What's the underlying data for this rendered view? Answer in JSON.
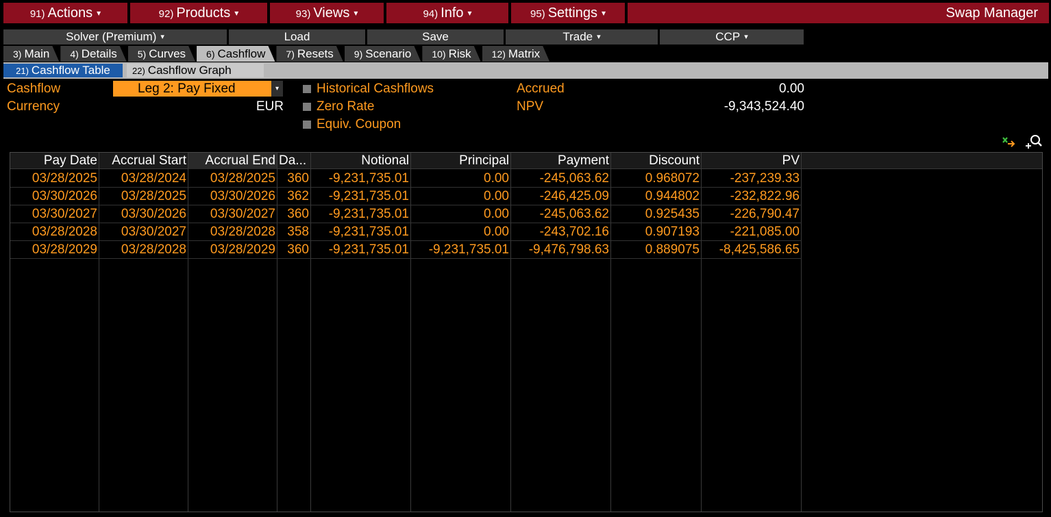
{
  "menubar": {
    "items": [
      {
        "num": "91)",
        "label": "Actions"
      },
      {
        "num": "92)",
        "label": "Products"
      },
      {
        "num": "93)",
        "label": "Views"
      },
      {
        "num": "94)",
        "label": "Info"
      },
      {
        "num": "95)",
        "label": "Settings"
      }
    ],
    "title": "Swap Manager"
  },
  "toolbar": {
    "solver": "Solver (Premium)",
    "load": "Load",
    "save": "Save",
    "trade": "Trade",
    "ccp": "CCP"
  },
  "tabs": [
    {
      "num": "3)",
      "label": "Main"
    },
    {
      "num": "4)",
      "label": "Details"
    },
    {
      "num": "5)",
      "label": "Curves"
    },
    {
      "num": "6)",
      "label": "Cashflow"
    },
    {
      "num": "7)",
      "label": "Resets"
    },
    {
      "num": "9)",
      "label": "Scenario"
    },
    {
      "num": "10)",
      "label": "Risk"
    },
    {
      "num": "12)",
      "label": "Matrix"
    }
  ],
  "active_tab": "Cashflow",
  "subtabs": {
    "table": {
      "num": "21)",
      "label": "Cashflow Table"
    },
    "graph": {
      "num": "22)",
      "label": "Cashflow Graph"
    }
  },
  "form": {
    "cashflow_label": "Cashflow",
    "cashflow_value": "Leg 2: Pay Fixed",
    "currency_label": "Currency",
    "currency_value": "EUR",
    "historical_label": "Historical Cashflows",
    "zero_rate_label": "Zero Rate",
    "equiv_coupon_label": "Equiv. Coupon",
    "accrued_label": "Accrued",
    "accrued_value": "0.00",
    "npv_label": "NPV",
    "npv_value": "-9,343,524.40"
  },
  "icons": {
    "export": "export-excel-icon",
    "zoom": "zoom-icon"
  },
  "colors": {
    "menu_red": "#8c0f1f",
    "orange": "#ff9a1f",
    "active_blue": "#1d5ba8"
  },
  "table": {
    "columns": [
      "Pay Date",
      "Accrual Start",
      "Accrual End",
      "Da...",
      "Notional",
      "Principal",
      "Payment",
      "Discount",
      "PV"
    ],
    "rows": [
      [
        "03/28/2025",
        "03/28/2024",
        "03/28/2025",
        "360",
        "-9,231,735.01",
        "0.00",
        "-245,063.62",
        "0.968072",
        "-237,239.33"
      ],
      [
        "03/30/2026",
        "03/28/2025",
        "03/30/2026",
        "362",
        "-9,231,735.01",
        "0.00",
        "-246,425.09",
        "0.944802",
        "-232,822.96"
      ],
      [
        "03/30/2027",
        "03/30/2026",
        "03/30/2027",
        "360",
        "-9,231,735.01",
        "0.00",
        "-245,063.62",
        "0.925435",
        "-226,790.47"
      ],
      [
        "03/28/2028",
        "03/30/2027",
        "03/28/2028",
        "358",
        "-9,231,735.01",
        "0.00",
        "-243,702.16",
        "0.907193",
        "-221,085.00"
      ],
      [
        "03/28/2029",
        "03/28/2028",
        "03/28/2029",
        "360",
        "-9,231,735.01",
        "-9,231,735.01",
        "-9,476,798.63",
        "0.889075",
        "-8,425,586.65"
      ]
    ]
  }
}
